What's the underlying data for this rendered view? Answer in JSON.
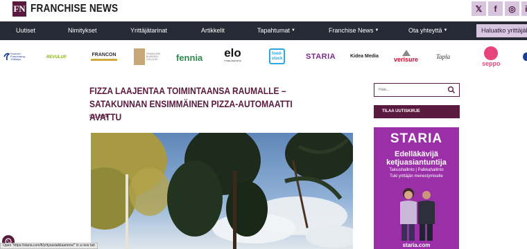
{
  "header": {
    "logo_mark": "FN",
    "brand": "FRANCHISE NEWS",
    "social": [
      {
        "icon": "x-icon",
        "glyph": "𝕏"
      },
      {
        "icon": "facebook-icon",
        "glyph": "f"
      },
      {
        "icon": "instagram-icon",
        "glyph": "◎"
      },
      {
        "icon": "linkedin-icon",
        "glyph": "in"
      }
    ]
  },
  "nav": {
    "items": [
      "Uutiset",
      "Nimitykset",
      "Yrittäjätarinat",
      "Artikkelit",
      "Tapahtumat",
      "Franchise News",
      "Ota yhteyttä"
    ],
    "cta": "Haluatko yrittäjäks"
  },
  "partners": [
    {
      "name": "Suomen Franchising-Yhdistys"
    },
    {
      "name": "REVULUP"
    },
    {
      "name": "FRANCON"
    },
    {
      "name": "FRANCHISE BUSINESS COLLEGE"
    },
    {
      "name": "fennia"
    },
    {
      "name": "elo",
      "sub": "TYÖELÄKEYHTIÖ"
    },
    {
      "name": "food-stock"
    },
    {
      "name": "STARIA"
    },
    {
      "name": "Kidea Media"
    },
    {
      "name": "verisure"
    },
    {
      "name": "Tapla"
    },
    {
      "name": "seppo"
    }
  ],
  "article": {
    "title": "Fizza laajentaa toimintaansa Raumalle – Satakunnan ensimmäinen pizza-automaatti avattu",
    "date": "5.11.2024"
  },
  "sidebar": {
    "search_placeholder": "Hae...",
    "newsletter": "TILAA UUTISKIRJE",
    "ad": {
      "logo": "STARIA",
      "headline_1": "Edelläkävijä",
      "headline_2": "ketjuasiantuntija",
      "sub_1": "Taloushallinto | Palkkahallinto",
      "sub_2": "Tuki yrittäjän menestymiselle",
      "url": "staria.com"
    }
  },
  "status": {
    "text": "Open \"https://staria.com/fi/yritysasiakkaamme/\" in a new tab"
  },
  "colors": {
    "brand": "#5a1a3f",
    "nav_bg": "#252a35",
    "social_bg": "#d7c4dd",
    "ad_bg": "#9b2fa8"
  }
}
